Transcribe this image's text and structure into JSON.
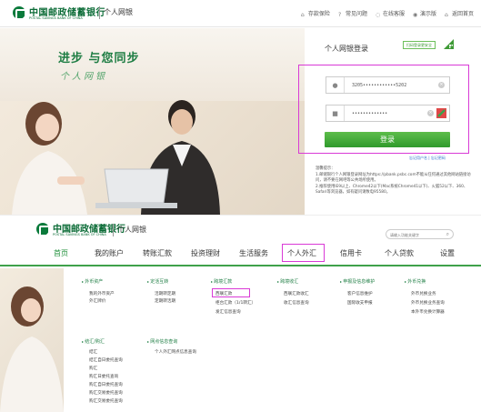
{
  "header": {
    "bank_name_cn": "中国邮政储蓄银行",
    "bank_name_en": "POSTAL SAVINGS BANK OF CHINA",
    "product": "个人网银",
    "links": [
      {
        "icon": "home-icon",
        "label": "存款保险"
      },
      {
        "icon": "question-icon",
        "label": "常见问题"
      },
      {
        "icon": "chat-icon",
        "label": "在线客服"
      },
      {
        "icon": "eye-icon",
        "label": "演示版"
      },
      {
        "icon": "house-icon",
        "label": "返回首页"
      }
    ]
  },
  "hero": {
    "slogan": "进步 与您同步",
    "subtitle": "个人网银"
  },
  "login": {
    "title": "个人网银登录",
    "qr_badge": "扫码登录更安全",
    "account_value": "3205••••••••••••5202",
    "password_value": "•••••••••••••",
    "button": "登录",
    "forgot_links": "忘记用户名 | 忘记密码",
    "tips": [
      "温馨提示：",
      "1.邮储银行个人网银登录网址为https://pbank.psbc.com不能从任何通过其他网站链接访问，请不要在网吧等公共场所使用。",
      "2.推荐使用IE9以上、Chrome42以下(Mac系统Chrome41以下)、火狐52以下、360、Safari等浏览器，如有疑问请致电95580。"
    ]
  },
  "header2": {
    "bank_name_cn": "中国邮政储蓄银行",
    "bank_name_en": "POSTAL SAVINGS BANK OF CHINA",
    "product": "个人网银",
    "search_placeholder": "请输入功能关键字"
  },
  "nav": {
    "items": [
      "首页",
      "我的账户",
      "转账汇款",
      "投资理财",
      "生活服务",
      "个人外汇",
      "信用卡",
      "个人贷款",
      "设置"
    ]
  },
  "dropdown": {
    "col1": {
      "title": "外币资产",
      "items": [
        "我的外币资产",
        "外汇牌价"
      ]
    },
    "col2": {
      "title": "定活互转",
      "items": [
        "活期转定期",
        "定期转活期"
      ]
    },
    "col3": {
      "title": "跨境汇款",
      "items": [
        "西联汇款",
        "柜台汇款（1/1转汇）",
        "发汇信息查询"
      ]
    },
    "col4": {
      "title": "跨境收汇",
      "items": [
        "西联汇款收汇",
        "收汇信息查询"
      ]
    },
    "col5": {
      "title": "申报及信息维护",
      "items": [
        "客户信息维护",
        "国际收支申报"
      ]
    },
    "col6": {
      "title": "外币兑换",
      "items": [
        "外币兑换业务",
        "外币兑换业务查询",
        "本外币兑换计算器"
      ]
    },
    "col7": {
      "title": "结汇/购汇",
      "items": [
        "结汇",
        "结汇自日委托查询",
        "购汇",
        "购汇日委托查询",
        "购汇自日委托查询",
        "购汇交易委托查询",
        "购汇交易委托查询"
      ]
    },
    "col8": {
      "title": "网点信息查询",
      "items": [
        "个人外汇网点信息查询"
      ]
    }
  }
}
